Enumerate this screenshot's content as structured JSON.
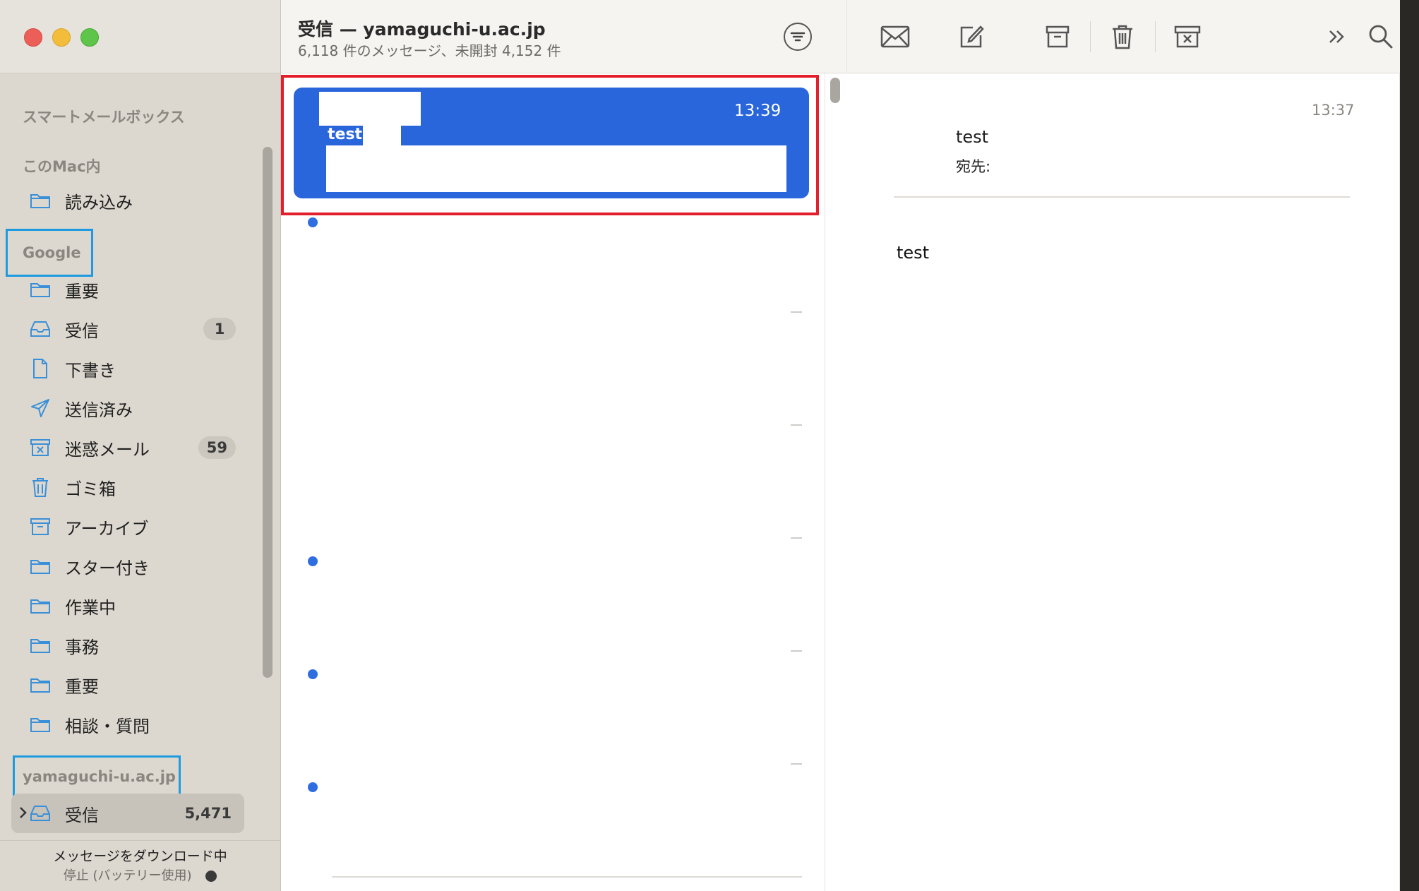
{
  "sidebar": {
    "smart_mailboxes": "スマートメールボックス",
    "on_my_mac": "このMac内",
    "import_folder": "読み込み",
    "google_account": "Google",
    "google_items": [
      {
        "label": "重要",
        "icon": "folder-icon",
        "badge": ""
      },
      {
        "label": "受信",
        "icon": "inbox-icon",
        "badge": "1"
      },
      {
        "label": "下書き",
        "icon": "draft-icon",
        "badge": ""
      },
      {
        "label": "送信済み",
        "icon": "sent-icon",
        "badge": ""
      },
      {
        "label": "迷惑メール",
        "icon": "junk-icon",
        "badge": "59"
      },
      {
        "label": "ゴミ箱",
        "icon": "trash-icon",
        "badge": ""
      },
      {
        "label": "アーカイブ",
        "icon": "archive-icon",
        "badge": ""
      },
      {
        "label": "スター付き",
        "icon": "folder-icon",
        "badge": ""
      },
      {
        "label": "作業中",
        "icon": "folder-icon",
        "badge": ""
      },
      {
        "label": "事務",
        "icon": "folder-icon",
        "badge": ""
      },
      {
        "label": "重要",
        "icon": "folder-icon",
        "badge": ""
      },
      {
        "label": "相談・質問",
        "icon": "folder-icon",
        "badge": ""
      }
    ],
    "yamaguchi_account": "yamaguchi-u.ac.jp",
    "yamaguchi_inbox": {
      "label": "受信",
      "badge": "5,471"
    },
    "download_status": "メッセージをダウンロード中",
    "download_sub": "停止 (バッテリー使用)"
  },
  "message_list": {
    "title": "受信 — yamaguchi-u.ac.jp",
    "subtitle": "6,118 件のメッセージ、未開封 4,152 件",
    "selected": {
      "time": "13:39",
      "subject": "test"
    }
  },
  "reading_pane": {
    "time": "13:37",
    "subject": "test",
    "to_label": "宛先:",
    "body": "test"
  },
  "colors": {
    "selection": "#2a66db",
    "highlight_red": "#e21f2a",
    "highlight_blue": "#1e9be0",
    "unread_dot": "#2f6ee0"
  }
}
